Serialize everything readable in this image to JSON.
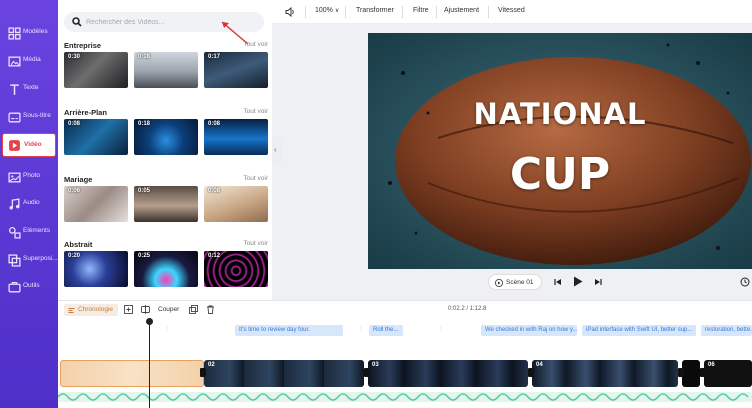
{
  "sidebar": {
    "items": [
      {
        "label": "Modèles",
        "icon": "templates-icon"
      },
      {
        "label": "Média",
        "icon": "media-icon"
      },
      {
        "label": "Texte",
        "icon": "text-icon"
      },
      {
        "label": "Sous-titre",
        "icon": "subtitle-icon"
      },
      {
        "label": "Vidéo",
        "icon": "video-icon",
        "active": true
      },
      {
        "label": "Photo",
        "icon": "photo-icon"
      },
      {
        "label": "Audio",
        "icon": "audio-icon"
      },
      {
        "label": "Eléments",
        "icon": "elements-icon"
      },
      {
        "label": "Superposi...",
        "icon": "overlay-icon"
      },
      {
        "label": "Outils",
        "icon": "tools-icon"
      }
    ]
  },
  "search": {
    "placeholder": "Rechercher des Vidéos..."
  },
  "library": {
    "see_all": "Tout voir",
    "categories": [
      {
        "title": "Entreprise",
        "durations": [
          "0:30",
          "0:08",
          "0:17"
        ]
      },
      {
        "title": "Arrière-Plan",
        "durations": [
          "0:08",
          "0:18",
          "0:08"
        ]
      },
      {
        "title": "Mariage",
        "durations": [
          "0:06",
          "0:05",
          "0:08"
        ]
      },
      {
        "title": "Abstrait",
        "durations": [
          "0:20",
          "0:25",
          "0:12"
        ]
      }
    ]
  },
  "toolbar": {
    "zoom": "100%",
    "transform": "Transformer",
    "filter": "Filtre",
    "adjust": "Ajustement",
    "speed": "Vitessed"
  },
  "preview": {
    "title_line1": "NATIONAL",
    "title_line2": "CUP",
    "scene_label": "Scène 01"
  },
  "timeline": {
    "chronology_label": "Chronologie",
    "cut_label": "Couper",
    "timecode": "0:02.2 / 1:12.8",
    "captions": [
      "It's time to review day four.",
      "Roll the...",
      "We checked in with Raj on how y...",
      "iPad interface with Swift UI, better sup...",
      "restoration, bette..."
    ],
    "clip_numbers": [
      "02",
      "03",
      "04",
      "06"
    ]
  },
  "colors": {
    "sidebar": "#5b3bd6",
    "active_border": "#e2444f",
    "timeline_accent": "#c87a3c",
    "caption_bg": "#d6e6fb",
    "audio_wave": "#5cc9a0"
  }
}
